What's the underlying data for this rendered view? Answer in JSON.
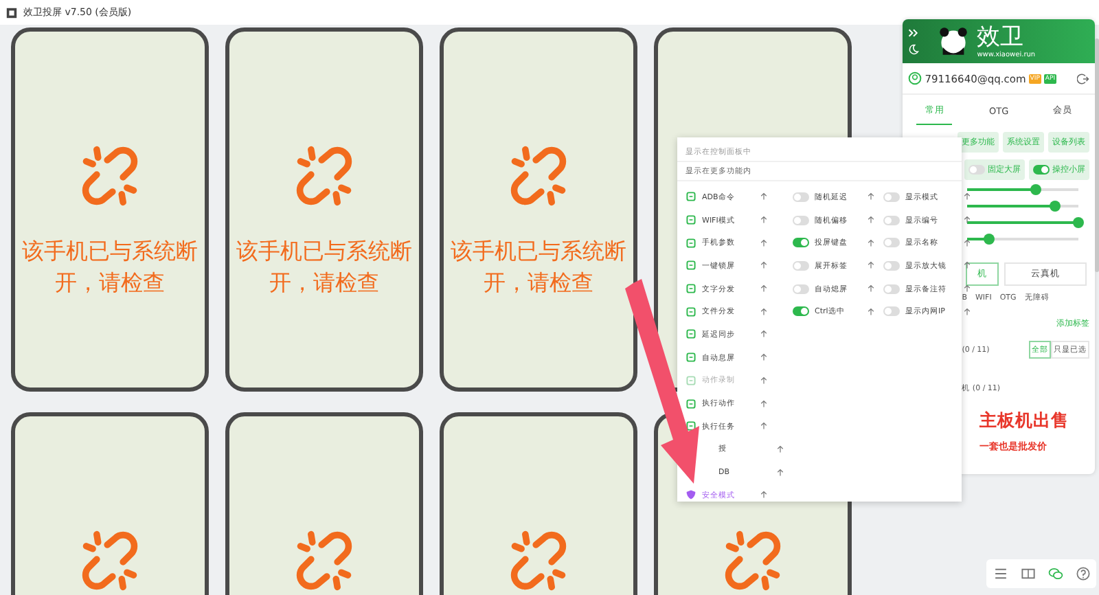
{
  "window": {
    "title": "效卫投屏 v7.50 (会员版)"
  },
  "devices": [
    {
      "kind": "disconnected",
      "message": "该手机已与系统断开，请检查"
    },
    {
      "kind": "disconnected",
      "message": "该手机已与系统断开，请检查"
    },
    {
      "kind": "disconnected",
      "message": "该手机已与系统断开，请检查"
    },
    {
      "kind": "covered"
    },
    {
      "kind": "disconnected"
    },
    {
      "kind": "disconnected"
    },
    {
      "kind": "disconnected"
    },
    {
      "kind": "disconnected"
    }
  ],
  "menu": {
    "headers": [
      "显示在控制面板中",
      "显示在更多功能内"
    ],
    "tools": [
      {
        "label": "ADB命令",
        "disabled": false,
        "selected": false
      },
      {
        "label": "WIFI模式",
        "disabled": false,
        "selected": false
      },
      {
        "label": "手机参数",
        "disabled": false,
        "selected": false
      },
      {
        "label": "一键锁屏",
        "disabled": false,
        "selected": false
      },
      {
        "label": "文字分发",
        "disabled": false,
        "selected": false
      },
      {
        "label": "文件分发",
        "disabled": false,
        "selected": false
      },
      {
        "label": "延迟同步",
        "disabled": false,
        "selected": false
      },
      {
        "label": "自动息屏",
        "disabled": false,
        "selected": false
      },
      {
        "label": "动作录制",
        "disabled": true,
        "selected": false
      },
      {
        "label": "执行动作",
        "disabled": false,
        "selected": false
      },
      {
        "label": "执行任务",
        "disabled": false,
        "selected": false
      },
      {
        "label": "授",
        "disabled": false,
        "selected": false
      },
      {
        "label": "DB",
        "disabled": false,
        "selected": false
      },
      {
        "label": "安全模式",
        "disabled": false,
        "selected": true
      }
    ],
    "switches": [
      {
        "label": "随机延迟",
        "on": false
      },
      {
        "label": "随机偏移",
        "on": false
      },
      {
        "label": "投屏键盘",
        "on": true
      },
      {
        "label": "展开标签",
        "on": false
      },
      {
        "label": "自动熄屏",
        "on": false
      },
      {
        "label": "Ctrl选中",
        "on": true
      }
    ],
    "display": [
      {
        "label": "显示模式",
        "on": false
      },
      {
        "label": "显示编号",
        "on": false
      },
      {
        "label": "显示名称",
        "on": false
      },
      {
        "label": "显示放大镜",
        "on": false
      },
      {
        "label": "显示备注符",
        "on": false
      },
      {
        "label": "显示内网IP",
        "on": false
      }
    ]
  },
  "panel": {
    "brand": "效卫",
    "site": "www.xiaowei.run",
    "account": "79116640@qq.com",
    "badges": [
      {
        "label": "VIP",
        "color": "#f5a623"
      },
      {
        "label": "API",
        "color": "#2db84d"
      }
    ],
    "tabs": [
      {
        "label": "常用",
        "selected": true
      },
      {
        "label": "OTG",
        "selected": false
      },
      {
        "label": "会员",
        "selected": false
      }
    ],
    "actions": [
      "更多功能",
      "系统设置",
      "设备列表"
    ],
    "toggles": [
      {
        "label": "固定大屏",
        "on": false
      },
      {
        "label": "操控小屏",
        "on": true
      }
    ],
    "sliders": [
      {
        "level": 0.62
      },
      {
        "level": 0.79
      },
      {
        "level": 1.0
      },
      {
        "level": 0.19
      }
    ],
    "device_types": [
      {
        "label": "机",
        "selected": true
      },
      {
        "label": "云真机",
        "selected": false
      }
    ],
    "filters": [
      "B",
      "WIFI",
      "OTG",
      "无障碍"
    ],
    "add_tag": "添加标签",
    "group_count": "(0 / 11)",
    "scope": [
      {
        "label": "全部",
        "selected": true
      },
      {
        "label": "只显已选",
        "selected": false
      }
    ],
    "group2": "机 (0 / 11)",
    "ad": {
      "headline": "主板机出售",
      "subline": "一套也是批发价"
    }
  }
}
